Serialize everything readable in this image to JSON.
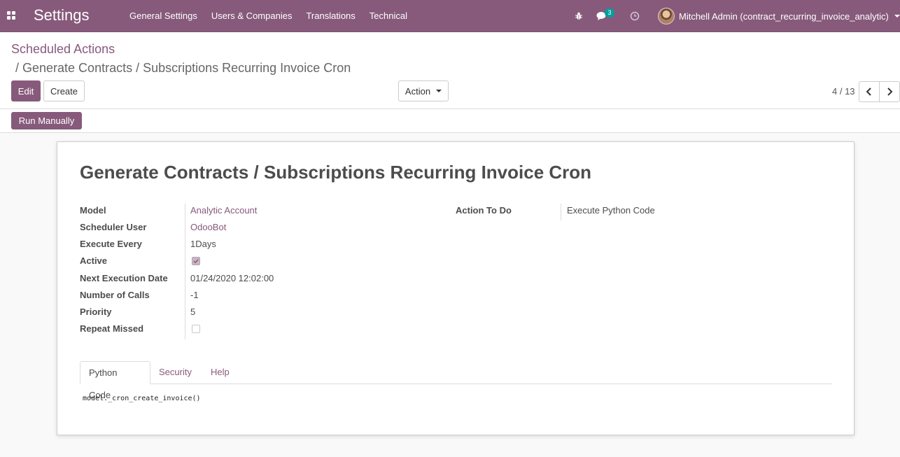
{
  "navbar": {
    "app_title": "Settings",
    "menu": [
      "General Settings",
      "Users & Companies",
      "Translations",
      "Technical"
    ],
    "messages_badge": "3",
    "user_name": "Mitchell Admin (contract_recurring_invoice_analytic)",
    "icons": [
      "apps-icon",
      "bug-icon",
      "chat-icon",
      "clock-icon",
      "avatar",
      "caret-down-icon"
    ]
  },
  "control_panel": {
    "breadcrumb_parent": "Scheduled Actions",
    "breadcrumb_current": "/ Generate Contracts / Subscriptions Recurring Invoice Cron",
    "edit_label": "Edit",
    "create_label": "Create",
    "action_label": "Action",
    "pager": "4 / 13",
    "run_manually_label": "Run Manually"
  },
  "form": {
    "title": "Generate Contracts / Subscriptions Recurring Invoice Cron",
    "fields": {
      "model": {
        "label": "Model",
        "value": "Analytic Account"
      },
      "scheduler_user": {
        "label": "Scheduler User",
        "value": "OdooBot"
      },
      "execute_every": {
        "label": "Execute Every",
        "value": "1Days"
      },
      "active": {
        "label": "Active",
        "checked": true
      },
      "next_execution_date": {
        "label": "Next Execution Date",
        "value": "01/24/2020 12:02:00"
      },
      "number_of_calls": {
        "label": "Number of Calls",
        "value": "-1"
      },
      "priority": {
        "label": "Priority",
        "value": "5"
      },
      "repeat_missed": {
        "label": "Repeat Missed",
        "checked": false
      },
      "action_to_do": {
        "label": "Action To Do",
        "value": "Execute Python Code"
      }
    },
    "tabs": [
      "Python Code",
      "Security",
      "Help"
    ],
    "active_tab": "Python Code",
    "code": "model._cron_create_invoice()"
  },
  "colors": {
    "brand": "#875a7b",
    "badge": "#00a09d"
  }
}
